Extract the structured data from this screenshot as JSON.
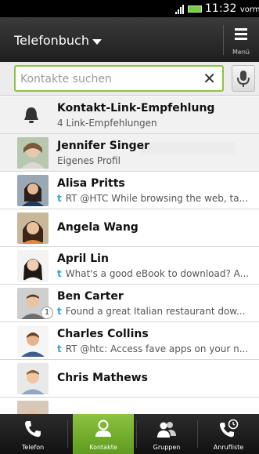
{
  "status_bar": {
    "time": "11:32",
    "time_suffix": "vorm.",
    "battery_color": "#6fd13a"
  },
  "header": {
    "title": "Telefonbuch",
    "menu_label": "Menü"
  },
  "search": {
    "placeholder": "Kontakte suchen",
    "value": "",
    "accent_color": "#8cc33f"
  },
  "link_suggestion": {
    "title": "Kontakt-Link-Empfehlung",
    "subtitle": "4 Link-Empfehlungen",
    "icon": "bell-icon"
  },
  "profile": {
    "name": "Jennifer Singer",
    "subtitle": "Eigenes Profil"
  },
  "contacts": [
    {
      "name": "Alisa Pritts",
      "status": "RT @HTC While browsing the web, ta...",
      "source_icon": "twitter-icon",
      "badge": ""
    },
    {
      "name": "Angela Wang",
      "status": "",
      "source_icon": "",
      "badge": ""
    },
    {
      "name": "April Lin",
      "status": "What's a good eBook to download? A...",
      "source_icon": "twitter-icon",
      "badge": ""
    },
    {
      "name": "Ben Carter",
      "status": "Found a great Italian restaurant dow...",
      "source_icon": "twitter-icon",
      "badge": "1"
    },
    {
      "name": "Charles Collins",
      "status": "RT @htc: Access fave apps on your n...",
      "source_icon": "twitter-icon",
      "badge": ""
    },
    {
      "name": "Chris Mathews",
      "status": "",
      "source_icon": "",
      "badge": ""
    }
  ],
  "bottom_nav": {
    "tabs": [
      {
        "label": "Telefon",
        "icon": "phone-icon",
        "active": false
      },
      {
        "label": "Kontakte",
        "icon": "person-icon",
        "active": true
      },
      {
        "label": "Gruppen",
        "icon": "group-icon",
        "active": false
      },
      {
        "label": "Anrufliste",
        "icon": "call-history-icon",
        "active": false
      }
    ],
    "active_color": "#8cc33f"
  }
}
